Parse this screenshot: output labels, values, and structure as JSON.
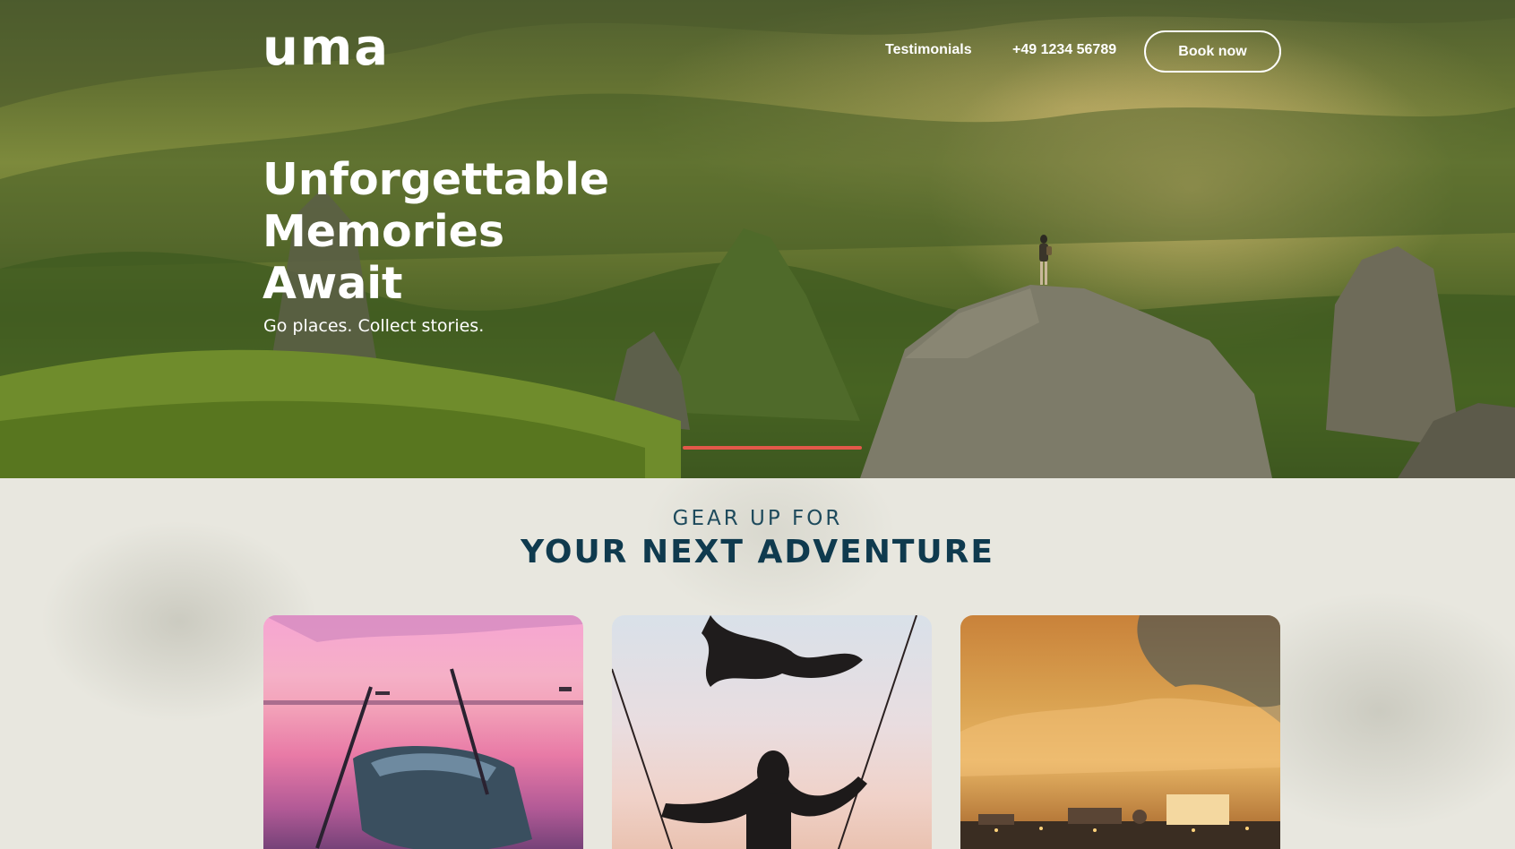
{
  "header": {
    "logo_text": "uma",
    "nav": {
      "testimonials_label": "Testimonials",
      "phone_label": "+49 1234 56789",
      "book_label": "Book now"
    }
  },
  "hero": {
    "title": "Unforgettable Memories Await",
    "subtitle": "Go places. Collect stories.",
    "slider_accent_color": "#e4584a"
  },
  "adventure": {
    "kicker": "GEAR UP FOR",
    "title": "YOUR NEXT ADVENTURE",
    "title_color": "#0f3a4e",
    "cards": [
      {
        "image": "rowboat-sunset-lake"
      },
      {
        "image": "person-on-swing"
      },
      {
        "image": "city-sunset-clouds"
      }
    ]
  }
}
